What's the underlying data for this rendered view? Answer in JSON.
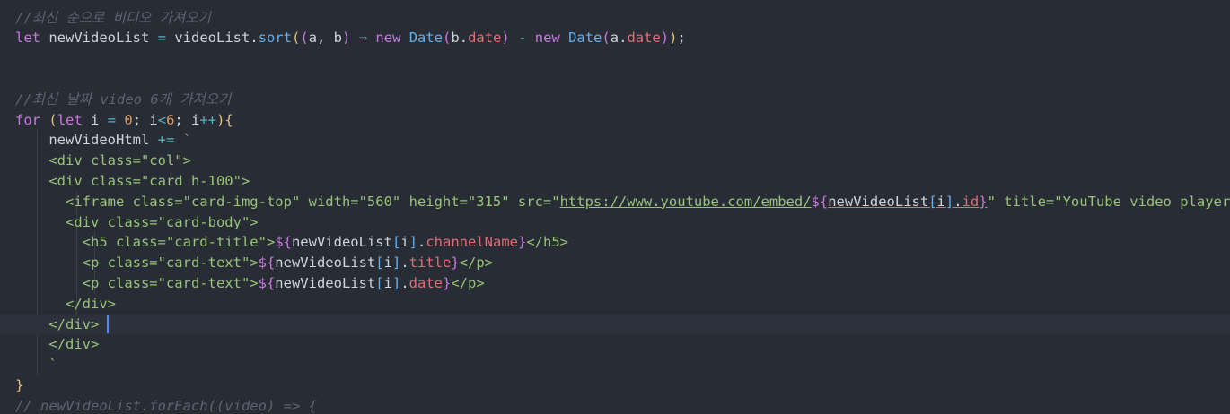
{
  "editor": {
    "lines": [
      [
        {
          "t": "//최신 순으로 비디오 가져오기",
          "c": "comment"
        }
      ],
      [
        {
          "t": "let",
          "c": "keyword"
        },
        {
          "t": " newVideoList ",
          "c": "var"
        },
        {
          "t": "=",
          "c": "op"
        },
        {
          "t": " videoList",
          "c": "var"
        },
        {
          "t": ".",
          "c": "punct"
        },
        {
          "t": "sort",
          "c": "func"
        },
        {
          "t": "(",
          "c": "paren1"
        },
        {
          "t": "(",
          "c": "paren2"
        },
        {
          "t": "a, b",
          "c": "var"
        },
        {
          "t": ")",
          "c": "paren2"
        },
        {
          "t": " ⇒ ",
          "c": "op"
        },
        {
          "t": "new",
          "c": "keyword"
        },
        {
          "t": " Date",
          "c": "func"
        },
        {
          "t": "(",
          "c": "paren2"
        },
        {
          "t": "b",
          "c": "var"
        },
        {
          "t": ".",
          "c": "punct"
        },
        {
          "t": "date",
          "c": "prop"
        },
        {
          "t": ")",
          "c": "paren2"
        },
        {
          "t": " - ",
          "c": "op"
        },
        {
          "t": "new",
          "c": "keyword"
        },
        {
          "t": " Date",
          "c": "func"
        },
        {
          "t": "(",
          "c": "paren2"
        },
        {
          "t": "a",
          "c": "var"
        },
        {
          "t": ".",
          "c": "punct"
        },
        {
          "t": "date",
          "c": "prop"
        },
        {
          "t": ")",
          "c": "paren2"
        },
        {
          "t": ")",
          "c": "paren1"
        },
        {
          "t": ";",
          "c": "punct"
        }
      ],
      [],
      [],
      [
        {
          "t": "//최신 날짜 video 6개 가져오기",
          "c": "comment"
        }
      ],
      [
        {
          "t": "for",
          "c": "keyword"
        },
        {
          "t": " ",
          "c": "var"
        },
        {
          "t": "(",
          "c": "paren1"
        },
        {
          "t": "let",
          "c": "keyword"
        },
        {
          "t": " i ",
          "c": "var"
        },
        {
          "t": "=",
          "c": "op"
        },
        {
          "t": " ",
          "c": "var"
        },
        {
          "t": "0",
          "c": "num"
        },
        {
          "t": "; i",
          "c": "var"
        },
        {
          "t": "<",
          "c": "op"
        },
        {
          "t": "6",
          "c": "num"
        },
        {
          "t": "; i",
          "c": "var"
        },
        {
          "t": "++",
          "c": "op"
        },
        {
          "t": ")",
          "c": "paren1"
        },
        {
          "t": "{",
          "c": "paren1"
        }
      ],
      [
        {
          "t": "    newVideoHtml ",
          "c": "var"
        },
        {
          "t": "+=",
          "c": "op"
        },
        {
          "t": " `",
          "c": "string"
        }
      ],
      [
        {
          "t": "    <div class=\"col\">",
          "c": "string"
        }
      ],
      [
        {
          "t": "    <div class=\"card h-100\">",
          "c": "string"
        }
      ],
      [
        {
          "t": "      <iframe class=\"card-img-top\" width=\"560\" height=\"315\" src=\"",
          "c": "string"
        },
        {
          "t": "https://www.youtube.com/embed/",
          "c": "url"
        },
        {
          "t": "${",
          "c": "interp"
        },
        {
          "t": "newVideoList",
          "c": "var",
          "u": true
        },
        {
          "t": "[",
          "c": "paren3",
          "u": true
        },
        {
          "t": "i",
          "c": "var",
          "u": true
        },
        {
          "t": "]",
          "c": "paren3",
          "u": true
        },
        {
          "t": ".",
          "c": "punct",
          "u": true
        },
        {
          "t": "id",
          "c": "prop",
          "u": true
        },
        {
          "t": "}",
          "c": "interp",
          "u": true
        },
        {
          "t": "\" title=\"YouTube video player\"",
          "c": "string"
        }
      ],
      [
        {
          "t": "      <div class=\"card-body\">",
          "c": "string"
        }
      ],
      [
        {
          "t": "        <h5 class=\"card-title\">",
          "c": "string"
        },
        {
          "t": "${",
          "c": "interp"
        },
        {
          "t": "newVideoList",
          "c": "var"
        },
        {
          "t": "[",
          "c": "paren3"
        },
        {
          "t": "i",
          "c": "var"
        },
        {
          "t": "]",
          "c": "paren3"
        },
        {
          "t": ".",
          "c": "punct"
        },
        {
          "t": "channelName",
          "c": "prop"
        },
        {
          "t": "}",
          "c": "interp"
        },
        {
          "t": "</h5>",
          "c": "string"
        }
      ],
      [
        {
          "t": "        <p class=\"card-text\">",
          "c": "string"
        },
        {
          "t": "${",
          "c": "interp"
        },
        {
          "t": "newVideoList",
          "c": "var"
        },
        {
          "t": "[",
          "c": "paren3"
        },
        {
          "t": "i",
          "c": "var"
        },
        {
          "t": "]",
          "c": "paren3"
        },
        {
          "t": ".",
          "c": "punct"
        },
        {
          "t": "title",
          "c": "prop"
        },
        {
          "t": "}",
          "c": "interp"
        },
        {
          "t": "</p>",
          "c": "string"
        }
      ],
      [
        {
          "t": "        <p class=\"card-text\">",
          "c": "string"
        },
        {
          "t": "${",
          "c": "interp"
        },
        {
          "t": "newVideoList",
          "c": "var"
        },
        {
          "t": "[",
          "c": "paren3"
        },
        {
          "t": "i",
          "c": "var"
        },
        {
          "t": "]",
          "c": "paren3"
        },
        {
          "t": ".",
          "c": "punct"
        },
        {
          "t": "date",
          "c": "prop"
        },
        {
          "t": "}",
          "c": "interp"
        },
        {
          "t": "</p>",
          "c": "string"
        }
      ],
      [
        {
          "t": "      </div>",
          "c": "string"
        }
      ],
      [
        {
          "t": "    </div>",
          "c": "string"
        }
      ],
      [
        {
          "t": "    </div>",
          "c": "string"
        }
      ],
      [
        {
          "t": "    `",
          "c": "string"
        }
      ],
      [
        {
          "t": "}",
          "c": "paren1"
        }
      ],
      [
        {
          "t": "// newVideoList.forEach((video) => {",
          "c": "comment"
        }
      ]
    ],
    "active_line": 15,
    "cursor": {
      "line": 15,
      "after_char": 10
    }
  },
  "theme": {
    "background": "#282c34",
    "active_line": "#2c313c",
    "cursor": "#528bff"
  }
}
